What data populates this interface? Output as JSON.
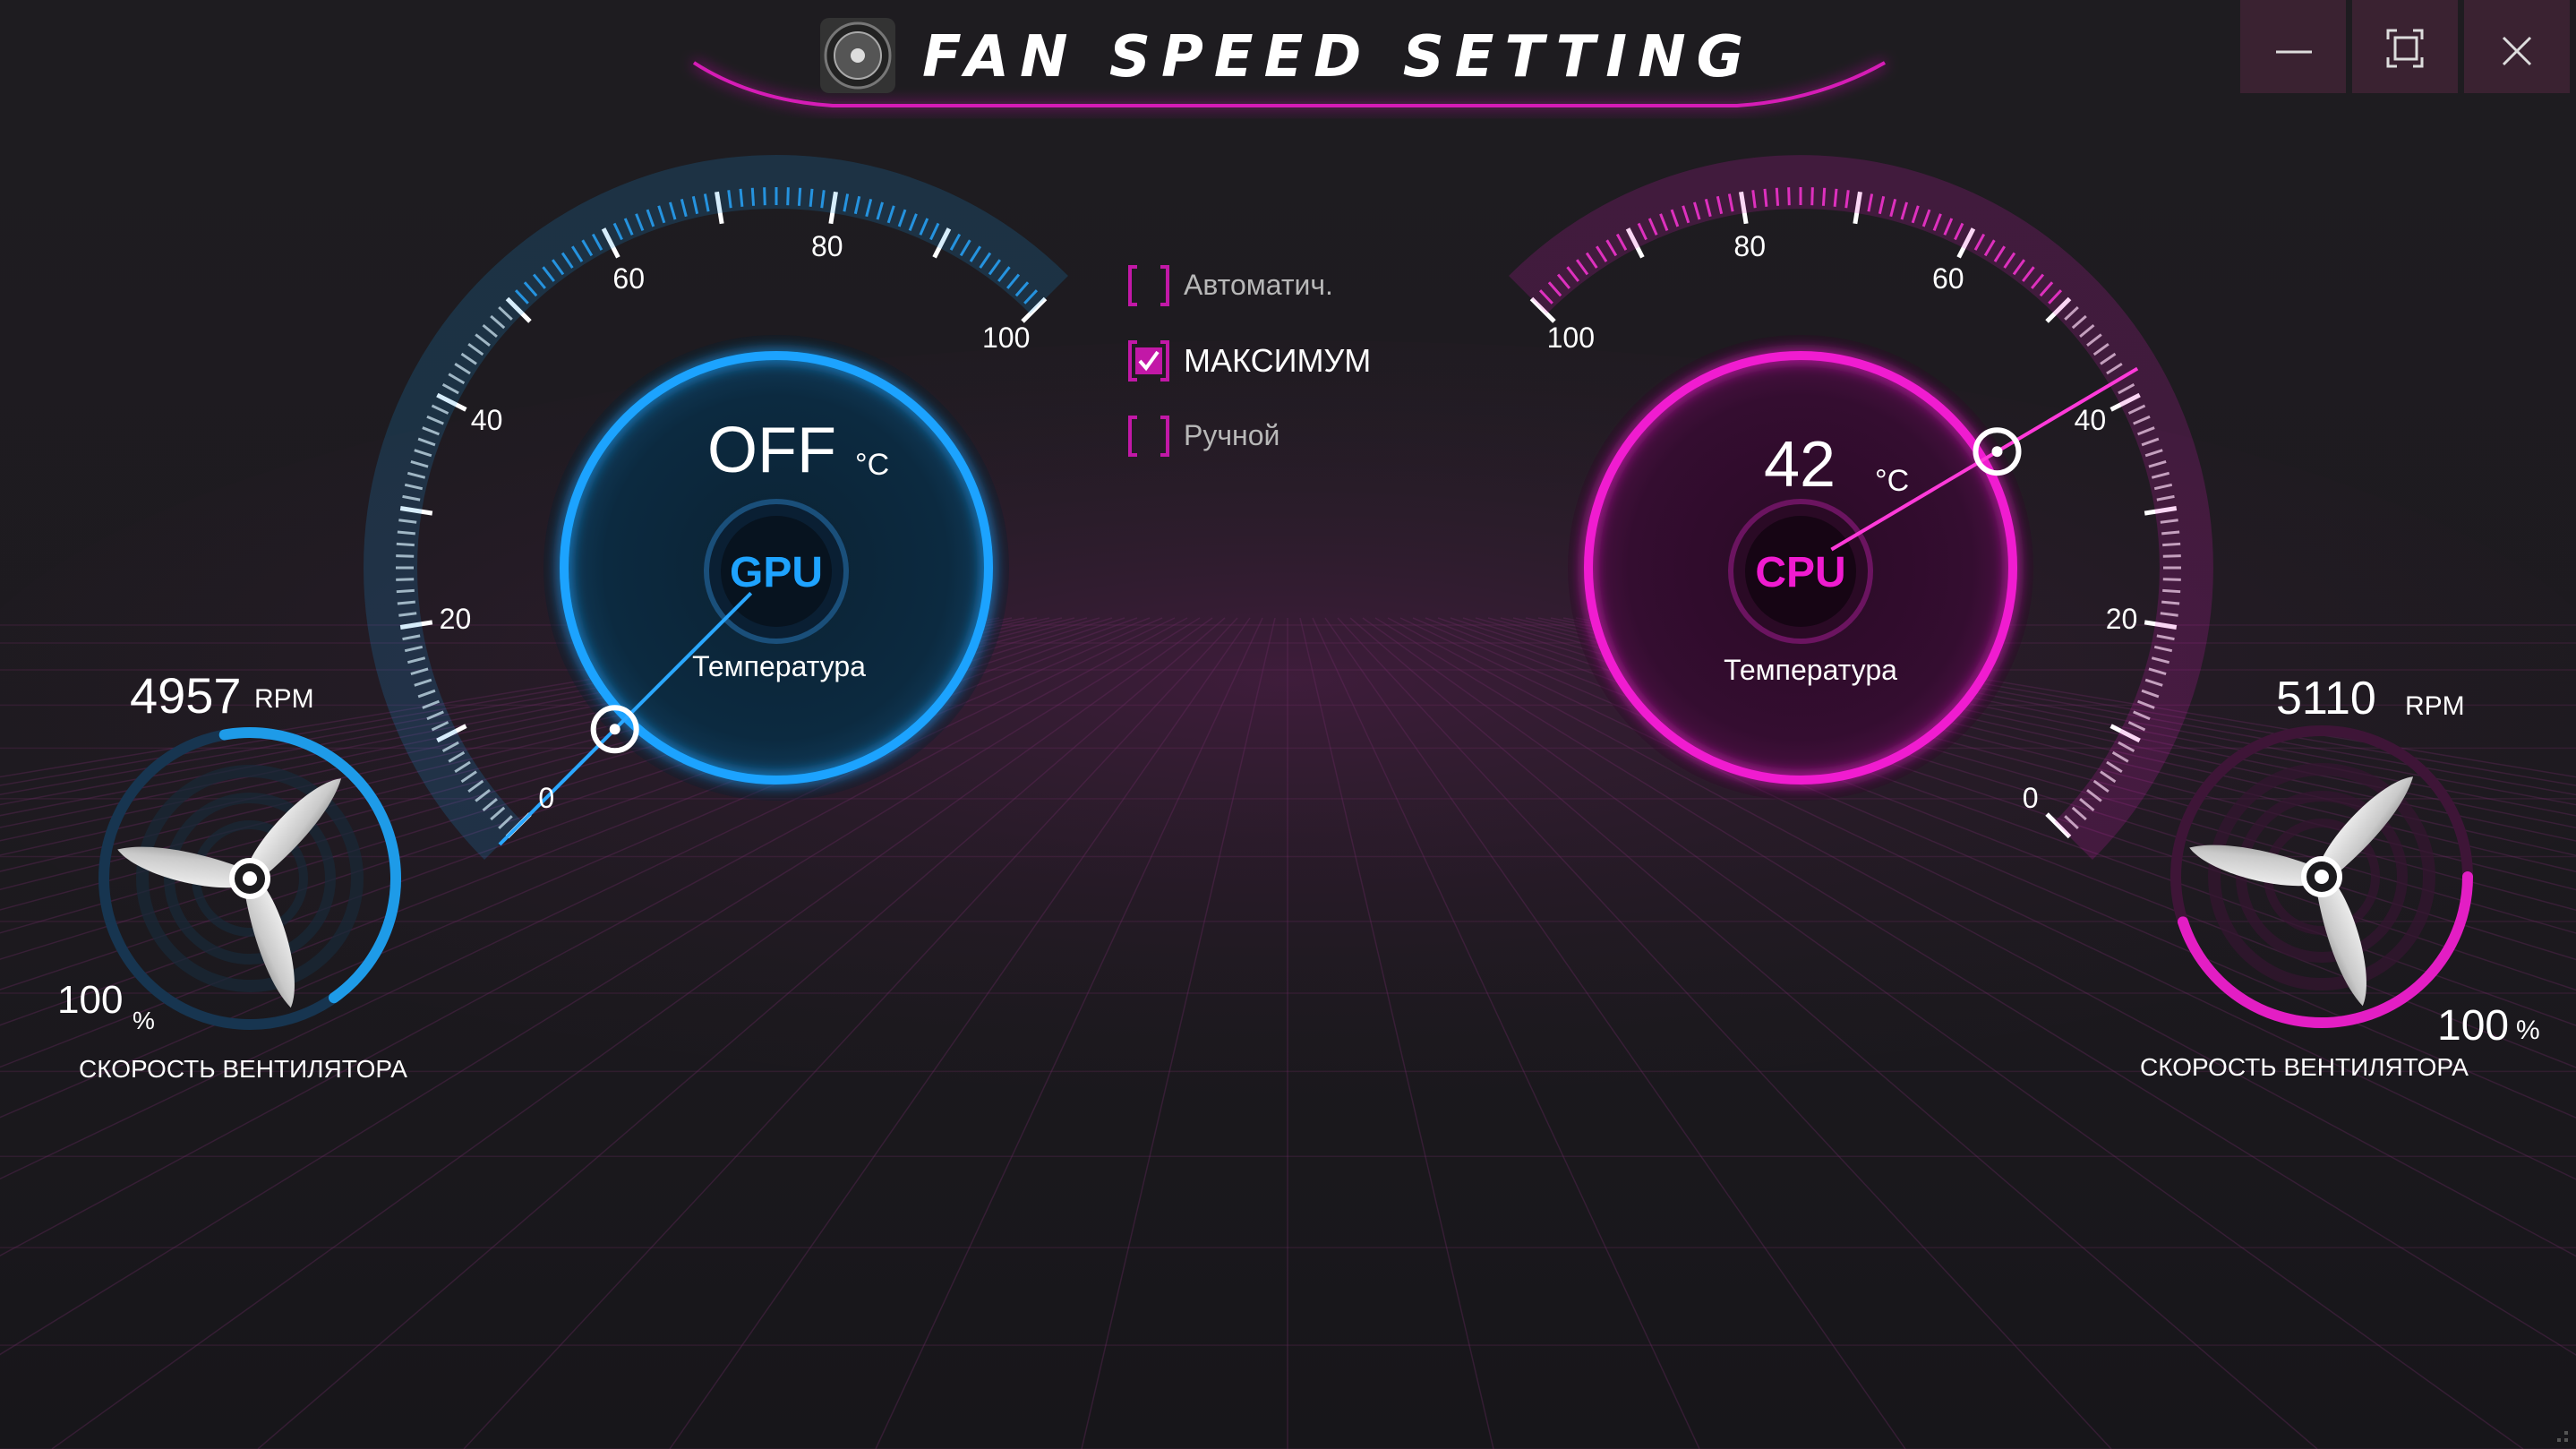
{
  "window": {
    "title": "FAN SPEED SETTING",
    "controls": [
      "minimize",
      "maximize",
      "close"
    ]
  },
  "modes": [
    {
      "label": "Автоматич.",
      "checked": false
    },
    {
      "label": "МАКСИМУМ",
      "checked": true
    },
    {
      "label": "Ручной",
      "checked": false
    }
  ],
  "gpu": {
    "chip": "GPU",
    "temp_value": "OFF",
    "temp_unit": "°C",
    "temp_caption": "Температура",
    "gauge_ticks": [
      "0",
      "20",
      "40",
      "60",
      "80",
      "100"
    ],
    "needle_value": 0,
    "rpm_value": "4957",
    "rpm_unit": "RPM",
    "fan_percent": "100",
    "percent_unit": "%",
    "fan_level": 0.43,
    "fan_caption": "СКОРОСТЬ ВЕНТИЛЯТОРА",
    "accent": "#1e9be8"
  },
  "cpu": {
    "chip": "CPU",
    "temp_value": "42",
    "temp_unit": "°C",
    "temp_caption": "Температура",
    "gauge_ticks": [
      "0",
      "20",
      "40",
      "60",
      "80",
      "100"
    ],
    "needle_value": 42,
    "rpm_value": "5110",
    "rpm_unit": "RPM",
    "fan_percent": "100",
    "percent_unit": "%",
    "fan_level": 0.45,
    "fan_caption": "СКОРОСТЬ ВЕНТИЛЯТОРА",
    "accent": "#e31ec4"
  }
}
